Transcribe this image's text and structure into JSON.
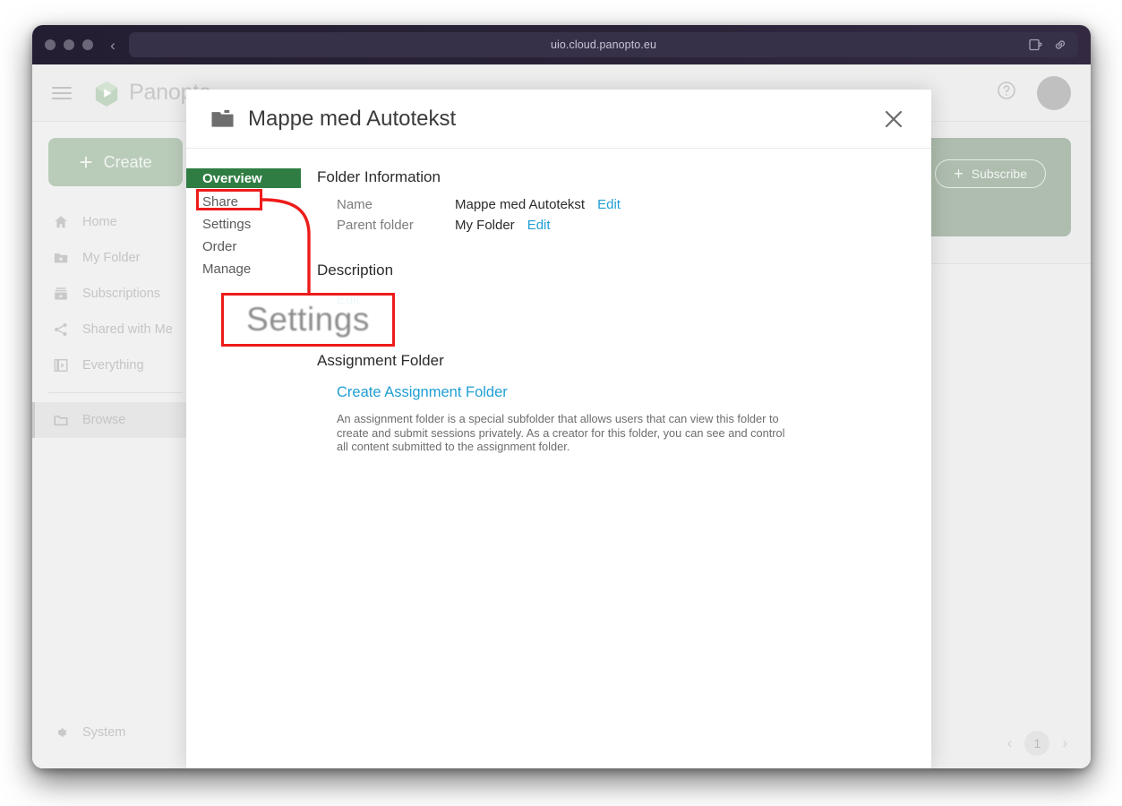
{
  "browser": {
    "url": "uio.cloud.panopto.eu",
    "back_icon": "chevron-left-icon",
    "extension_icon": "extension-puzzle-icon",
    "link_icon": "link-icon"
  },
  "app": {
    "brand": "Panopto",
    "menu_icon": "hamburger-menu-icon",
    "help_icon": "help-circle-icon",
    "avatar_icon": "user-avatar",
    "create_label": "Create",
    "sidebar": {
      "items": [
        {
          "label": "Home",
          "icon": "home-icon"
        },
        {
          "label": "My Folder",
          "icon": "folder-star-icon"
        },
        {
          "label": "Subscriptions",
          "icon": "subscriptions-icon"
        },
        {
          "label": "Shared with Me",
          "icon": "share-icon"
        },
        {
          "label": "Everything",
          "icon": "video-library-icon"
        },
        {
          "label": "Browse",
          "icon": "folder-outline-icon"
        }
      ],
      "system_label": "System",
      "system_icon": "gear-icon"
    },
    "banner": {
      "subscribe_label": "Subscribe",
      "subscribe_icon": "plus-icon"
    },
    "pagination": {
      "prev_icon": "chevron-left-icon",
      "page": "1",
      "next_icon": "chevron-right-icon"
    }
  },
  "modal": {
    "title": "Mappe med Autotekst",
    "folder_icon": "folder-icon",
    "close_icon": "close-x-icon",
    "nav": [
      {
        "label": "Overview",
        "active": true
      },
      {
        "label": "Share",
        "active": false
      },
      {
        "label": "Settings",
        "active": false
      },
      {
        "label": "Order",
        "active": false
      },
      {
        "label": "Manage",
        "active": false
      }
    ],
    "folder_information": {
      "heading": "Folder Information",
      "name_label": "Name",
      "name_value": "Mappe med Autotekst",
      "name_edit": "Edit",
      "parent_label": "Parent folder",
      "parent_value": "My Folder",
      "parent_edit": "Edit"
    },
    "description": {
      "heading": "Description",
      "edit": "Edit"
    },
    "assignment": {
      "heading": "Assignment Folder",
      "create_link": "Create Assignment Folder",
      "body": "An assignment folder is a special subfolder that allows users that can view this folder to create and submit sessions privately. As a creator for this folder, you can see and control all content submitted to the assignment folder."
    }
  },
  "annotations": {
    "callout_label": "Settings",
    "highlight_color": "#ee1b1b",
    "arrow_icon": "curved-arrow"
  },
  "colors": {
    "accent_green": "#2f7d43",
    "link_blue": "#1f9fd4",
    "annotation_red": "#ee1b1b",
    "titlebar": "#241f33"
  }
}
